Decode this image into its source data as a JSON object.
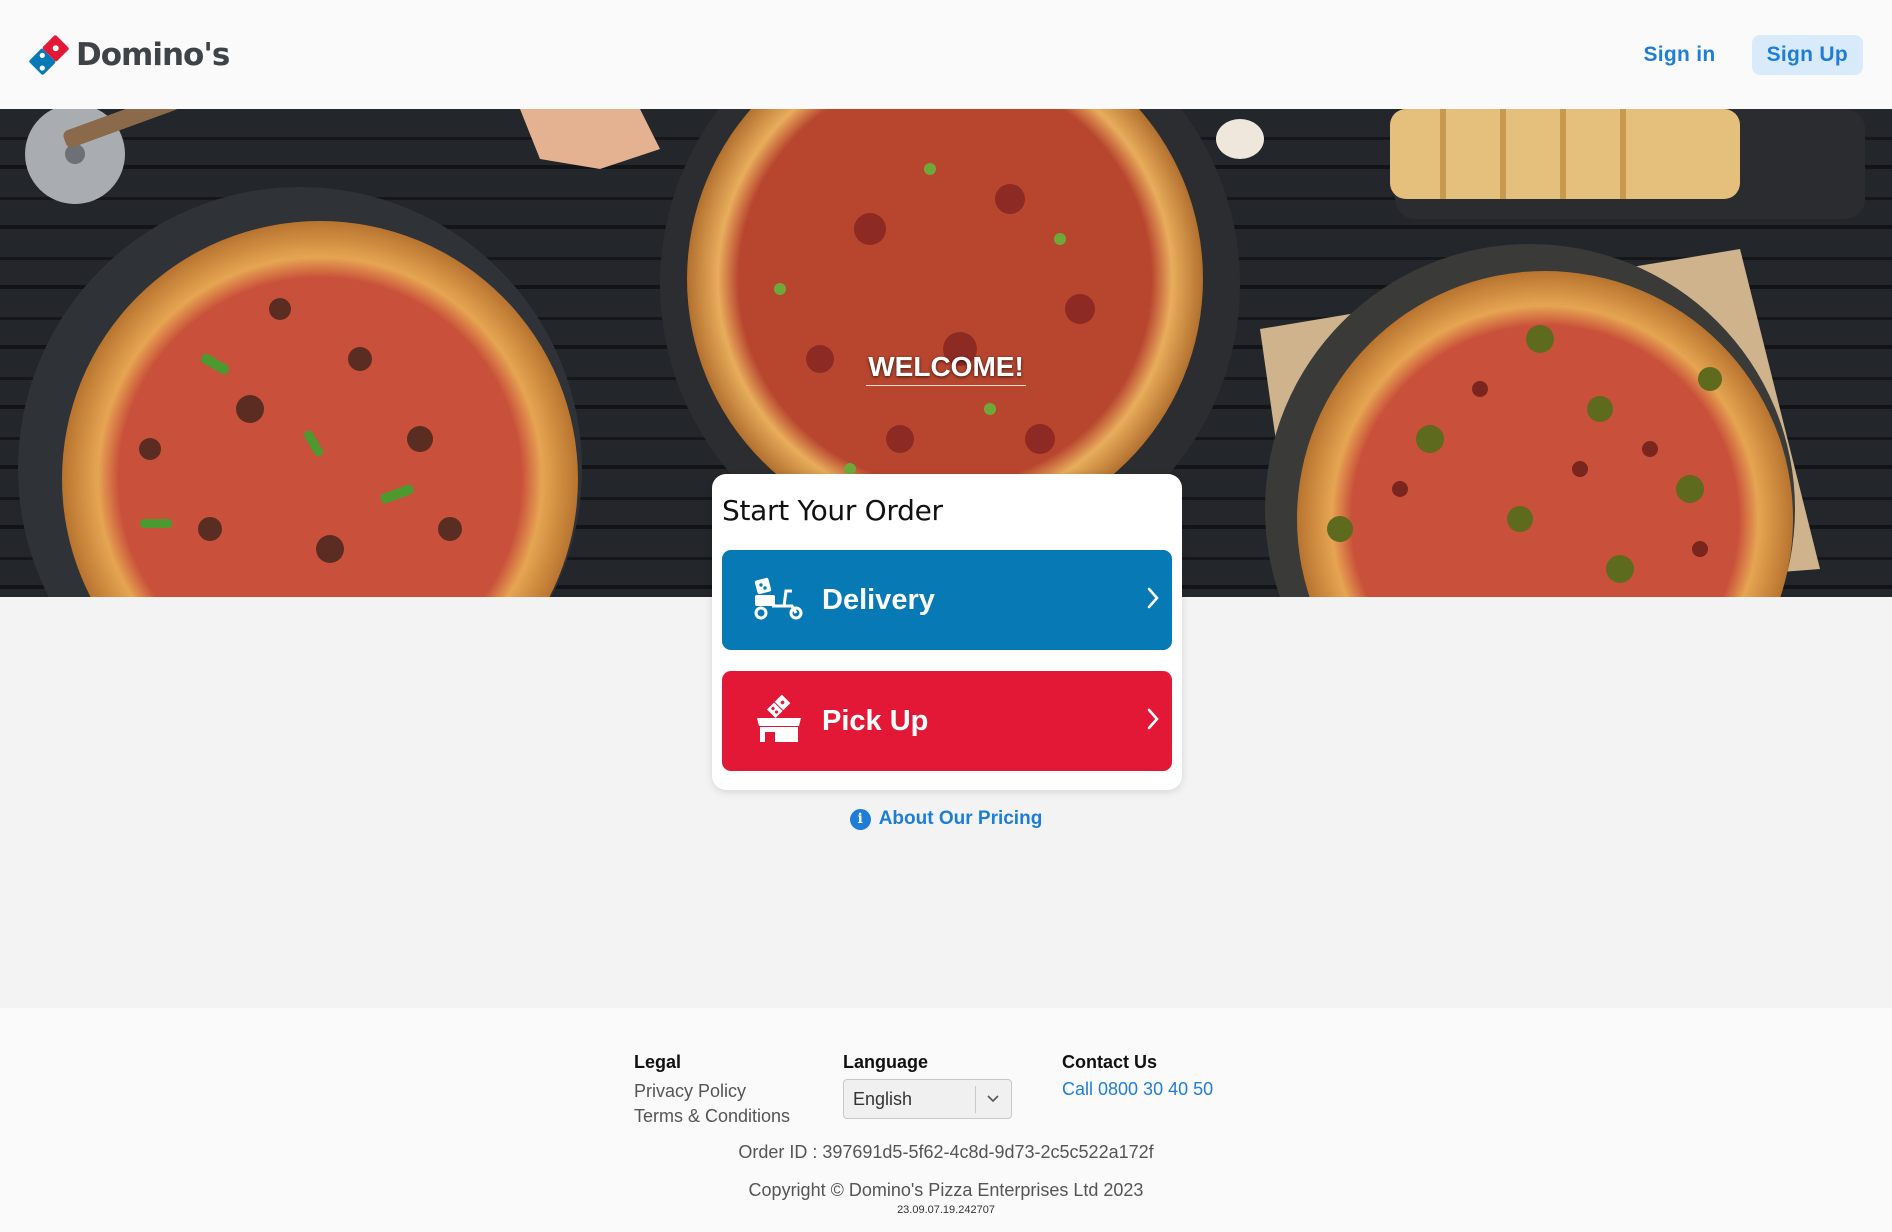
{
  "header": {
    "brand": "Domino's",
    "sign_in": "Sign in",
    "sign_up": "Sign Up"
  },
  "hero": {
    "welcome": "WELCOME!"
  },
  "order_card": {
    "title": "Start Your Order",
    "delivery_label": "Delivery",
    "pickup_label": "Pick Up",
    "icons": {
      "delivery": "delivery-scooter-icon",
      "pickup": "store-pickup-icon",
      "chevron": "chevron-right-icon"
    }
  },
  "pricing": {
    "info_glyph": "i",
    "label": "About Our Pricing"
  },
  "footer": {
    "legal": {
      "heading": "Legal",
      "links": [
        "Privacy Policy",
        "Terms & Conditions"
      ]
    },
    "language": {
      "heading": "Language",
      "selected": "English"
    },
    "contact": {
      "heading": "Contact Us",
      "phone": "Call 0800 30 40 50"
    },
    "order_id": "Order ID : 397691d5-5f62-4c8d-9d73-2c5c522a172f",
    "copyright": "Copyright © Domino's Pizza Enterprises Ltd 2023",
    "version": "23.09.07.19.242707"
  },
  "colors": {
    "brand_blue": "#0779b5",
    "brand_red": "#e31837",
    "link_blue": "#1e7ed7",
    "signup_bg": "#d9ebfb"
  }
}
